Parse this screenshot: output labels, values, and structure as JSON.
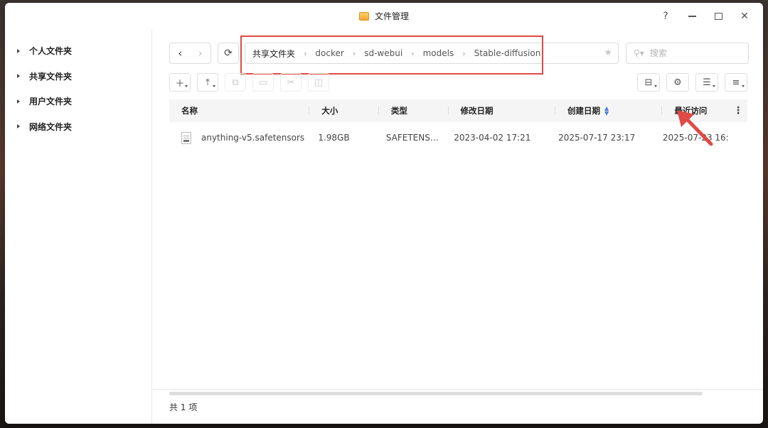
{
  "window": {
    "title": "文件管理"
  },
  "window_controls": {
    "help": "?"
  },
  "sidebar": {
    "items": [
      {
        "label": "个人文件夹"
      },
      {
        "label": "共享文件夹"
      },
      {
        "label": "用户文件夹"
      },
      {
        "label": "网络文件夹"
      }
    ]
  },
  "path": {
    "crumbs": [
      "共享文件夹",
      "docker",
      "sd-webui",
      "models",
      "Stable-diffusion"
    ]
  },
  "search": {
    "placeholder": "搜索",
    "value": ""
  },
  "table": {
    "columns": [
      "名称",
      "大小",
      "类型",
      "修改日期",
      "创建日期",
      "最近访问"
    ],
    "sort_column": "创建日期",
    "rows": [
      {
        "name": "anything-v5.safetensors",
        "size": "1.98GB",
        "type": "SAFETENSORS",
        "modified": "2023-04-02 17:21",
        "created": "2025-07-17 23:17",
        "accessed": "2025-07-23 16:"
      }
    ]
  },
  "footer": {
    "count": "共 1 项"
  },
  "colors": {
    "highlight": "#e04a45",
    "sort_icon": "#4a7bd0"
  }
}
